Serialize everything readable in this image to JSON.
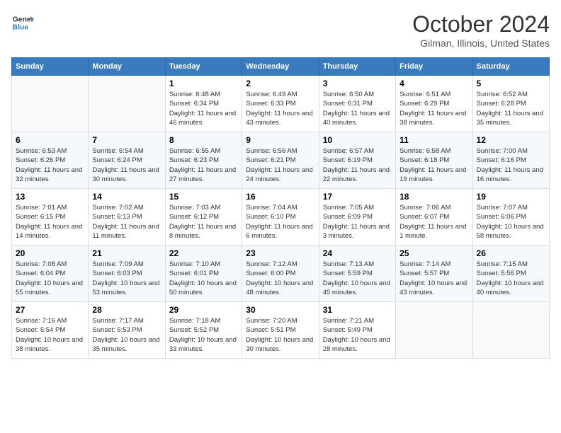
{
  "header": {
    "logo_line1": "General",
    "logo_line2": "Blue",
    "month": "October 2024",
    "location": "Gilman, Illinois, United States"
  },
  "days_of_week": [
    "Sunday",
    "Monday",
    "Tuesday",
    "Wednesday",
    "Thursday",
    "Friday",
    "Saturday"
  ],
  "weeks": [
    [
      {
        "day": "",
        "sunrise": "",
        "sunset": "",
        "daylight": ""
      },
      {
        "day": "",
        "sunrise": "",
        "sunset": "",
        "daylight": ""
      },
      {
        "day": "1",
        "sunrise": "Sunrise: 6:48 AM",
        "sunset": "Sunset: 6:34 PM",
        "daylight": "Daylight: 11 hours and 46 minutes."
      },
      {
        "day": "2",
        "sunrise": "Sunrise: 6:49 AM",
        "sunset": "Sunset: 6:33 PM",
        "daylight": "Daylight: 11 hours and 43 minutes."
      },
      {
        "day": "3",
        "sunrise": "Sunrise: 6:50 AM",
        "sunset": "Sunset: 6:31 PM",
        "daylight": "Daylight: 11 hours and 40 minutes."
      },
      {
        "day": "4",
        "sunrise": "Sunrise: 6:51 AM",
        "sunset": "Sunset: 6:29 PM",
        "daylight": "Daylight: 11 hours and 38 minutes."
      },
      {
        "day": "5",
        "sunrise": "Sunrise: 6:52 AM",
        "sunset": "Sunset: 6:28 PM",
        "daylight": "Daylight: 11 hours and 35 minutes."
      }
    ],
    [
      {
        "day": "6",
        "sunrise": "Sunrise: 6:53 AM",
        "sunset": "Sunset: 6:26 PM",
        "daylight": "Daylight: 11 hours and 32 minutes."
      },
      {
        "day": "7",
        "sunrise": "Sunrise: 6:54 AM",
        "sunset": "Sunset: 6:24 PM",
        "daylight": "Daylight: 11 hours and 30 minutes."
      },
      {
        "day": "8",
        "sunrise": "Sunrise: 6:55 AM",
        "sunset": "Sunset: 6:23 PM",
        "daylight": "Daylight: 11 hours and 27 minutes."
      },
      {
        "day": "9",
        "sunrise": "Sunrise: 6:56 AM",
        "sunset": "Sunset: 6:21 PM",
        "daylight": "Daylight: 11 hours and 24 minutes."
      },
      {
        "day": "10",
        "sunrise": "Sunrise: 6:57 AM",
        "sunset": "Sunset: 6:19 PM",
        "daylight": "Daylight: 11 hours and 22 minutes."
      },
      {
        "day": "11",
        "sunrise": "Sunrise: 6:58 AM",
        "sunset": "Sunset: 6:18 PM",
        "daylight": "Daylight: 11 hours and 19 minutes."
      },
      {
        "day": "12",
        "sunrise": "Sunrise: 7:00 AM",
        "sunset": "Sunset: 6:16 PM",
        "daylight": "Daylight: 11 hours and 16 minutes."
      }
    ],
    [
      {
        "day": "13",
        "sunrise": "Sunrise: 7:01 AM",
        "sunset": "Sunset: 6:15 PM",
        "daylight": "Daylight: 11 hours and 14 minutes."
      },
      {
        "day": "14",
        "sunrise": "Sunrise: 7:02 AM",
        "sunset": "Sunset: 6:13 PM",
        "daylight": "Daylight: 11 hours and 11 minutes."
      },
      {
        "day": "15",
        "sunrise": "Sunrise: 7:03 AM",
        "sunset": "Sunset: 6:12 PM",
        "daylight": "Daylight: 11 hours and 8 minutes."
      },
      {
        "day": "16",
        "sunrise": "Sunrise: 7:04 AM",
        "sunset": "Sunset: 6:10 PM",
        "daylight": "Daylight: 11 hours and 6 minutes."
      },
      {
        "day": "17",
        "sunrise": "Sunrise: 7:05 AM",
        "sunset": "Sunset: 6:09 PM",
        "daylight": "Daylight: 11 hours and 3 minutes."
      },
      {
        "day": "18",
        "sunrise": "Sunrise: 7:06 AM",
        "sunset": "Sunset: 6:07 PM",
        "daylight": "Daylight: 11 hours and 1 minute."
      },
      {
        "day": "19",
        "sunrise": "Sunrise: 7:07 AM",
        "sunset": "Sunset: 6:06 PM",
        "daylight": "Daylight: 10 hours and 58 minutes."
      }
    ],
    [
      {
        "day": "20",
        "sunrise": "Sunrise: 7:08 AM",
        "sunset": "Sunset: 6:04 PM",
        "daylight": "Daylight: 10 hours and 55 minutes."
      },
      {
        "day": "21",
        "sunrise": "Sunrise: 7:09 AM",
        "sunset": "Sunset: 6:03 PM",
        "daylight": "Daylight: 10 hours and 53 minutes."
      },
      {
        "day": "22",
        "sunrise": "Sunrise: 7:10 AM",
        "sunset": "Sunset: 6:01 PM",
        "daylight": "Daylight: 10 hours and 50 minutes."
      },
      {
        "day": "23",
        "sunrise": "Sunrise: 7:12 AM",
        "sunset": "Sunset: 6:00 PM",
        "daylight": "Daylight: 10 hours and 48 minutes."
      },
      {
        "day": "24",
        "sunrise": "Sunrise: 7:13 AM",
        "sunset": "Sunset: 5:59 PM",
        "daylight": "Daylight: 10 hours and 45 minutes."
      },
      {
        "day": "25",
        "sunrise": "Sunrise: 7:14 AM",
        "sunset": "Sunset: 5:57 PM",
        "daylight": "Daylight: 10 hours and 43 minutes."
      },
      {
        "day": "26",
        "sunrise": "Sunrise: 7:15 AM",
        "sunset": "Sunset: 5:56 PM",
        "daylight": "Daylight: 10 hours and 40 minutes."
      }
    ],
    [
      {
        "day": "27",
        "sunrise": "Sunrise: 7:16 AM",
        "sunset": "Sunset: 5:54 PM",
        "daylight": "Daylight: 10 hours and 38 minutes."
      },
      {
        "day": "28",
        "sunrise": "Sunrise: 7:17 AM",
        "sunset": "Sunset: 5:53 PM",
        "daylight": "Daylight: 10 hours and 35 minutes."
      },
      {
        "day": "29",
        "sunrise": "Sunrise: 7:18 AM",
        "sunset": "Sunset: 5:52 PM",
        "daylight": "Daylight: 10 hours and 33 minutes."
      },
      {
        "day": "30",
        "sunrise": "Sunrise: 7:20 AM",
        "sunset": "Sunset: 5:51 PM",
        "daylight": "Daylight: 10 hours and 30 minutes."
      },
      {
        "day": "31",
        "sunrise": "Sunrise: 7:21 AM",
        "sunset": "Sunset: 5:49 PM",
        "daylight": "Daylight: 10 hours and 28 minutes."
      },
      {
        "day": "",
        "sunrise": "",
        "sunset": "",
        "daylight": ""
      },
      {
        "day": "",
        "sunrise": "",
        "sunset": "",
        "daylight": ""
      }
    ]
  ]
}
